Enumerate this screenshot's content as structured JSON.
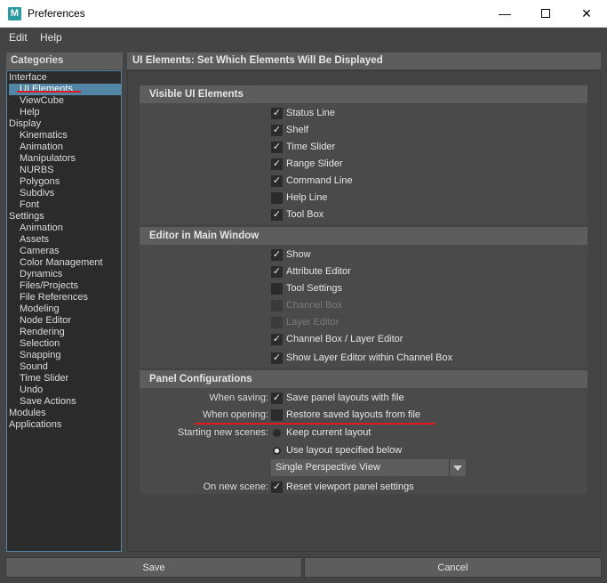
{
  "window": {
    "title": "Preferences",
    "app_icon": "M"
  },
  "menu": [
    "Edit",
    "Help"
  ],
  "categories_header": "Categories",
  "categories": [
    {
      "label": "Interface",
      "level": 0
    },
    {
      "label": "UI Elements",
      "level": 1,
      "selected": true
    },
    {
      "label": "ViewCube",
      "level": 1
    },
    {
      "label": "Help",
      "level": 1
    },
    {
      "label": "Display",
      "level": 0
    },
    {
      "label": "Kinematics",
      "level": 1
    },
    {
      "label": "Animation",
      "level": 1
    },
    {
      "label": "Manipulators",
      "level": 1
    },
    {
      "label": "NURBS",
      "level": 1
    },
    {
      "label": "Polygons",
      "level": 1
    },
    {
      "label": "Subdivs",
      "level": 1
    },
    {
      "label": "Font",
      "level": 1
    },
    {
      "label": "Settings",
      "level": 0
    },
    {
      "label": "Animation",
      "level": 1
    },
    {
      "label": "Assets",
      "level": 1
    },
    {
      "label": "Cameras",
      "level": 1
    },
    {
      "label": "Color Management",
      "level": 1
    },
    {
      "label": "Dynamics",
      "level": 1
    },
    {
      "label": "Files/Projects",
      "level": 1
    },
    {
      "label": "File References",
      "level": 1
    },
    {
      "label": "Modeling",
      "level": 1
    },
    {
      "label": "Node Editor",
      "level": 1
    },
    {
      "label": "Rendering",
      "level": 1
    },
    {
      "label": "Selection",
      "level": 1
    },
    {
      "label": "Snapping",
      "level": 1
    },
    {
      "label": "Sound",
      "level": 1
    },
    {
      "label": "Time Slider",
      "level": 1
    },
    {
      "label": "Undo",
      "level": 1
    },
    {
      "label": "Save Actions",
      "level": 1
    },
    {
      "label": "Modules",
      "level": 0
    },
    {
      "label": "Applications",
      "level": 0
    }
  ],
  "pane_title": "UI Elements: Set Which Elements Will Be Displayed",
  "visible_ui": {
    "header": "Visible UI Elements",
    "items": [
      {
        "label": "Status Line",
        "checked": true
      },
      {
        "label": "Shelf",
        "checked": true
      },
      {
        "label": "Time Slider",
        "checked": true
      },
      {
        "label": "Range Slider",
        "checked": true
      },
      {
        "label": "Command Line",
        "checked": true
      },
      {
        "label": "Help Line",
        "checked": false
      },
      {
        "label": "Tool Box",
        "checked": true
      }
    ]
  },
  "editor_main": {
    "header": "Editor in Main Window",
    "items": [
      {
        "label": "Show",
        "checked": true
      },
      {
        "label": "Attribute Editor",
        "checked": true
      },
      {
        "label": "Tool Settings",
        "checked": false
      },
      {
        "label": "Channel Box",
        "checked": false,
        "disabled": true
      },
      {
        "label": "Layer Editor",
        "checked": false,
        "disabled": true
      },
      {
        "label": "Channel Box / Layer Editor",
        "checked": true
      },
      {
        "label": "Show Layer Editor within Channel Box",
        "checked": true
      }
    ]
  },
  "panel_config": {
    "header": "Panel Configurations",
    "when_saving_label": "When saving:",
    "when_saving_option": "Save panel layouts with file",
    "when_opening_label": "When opening:",
    "when_opening_option": "Restore saved layouts from file",
    "new_scenes_label": "Starting new scenes:",
    "radio_keep": "Keep current layout",
    "radio_use": "Use layout specified below",
    "layout_value": "Single Perspective View",
    "on_new_scene_label": "On new scene:",
    "on_new_scene_option": "Reset viewport panel settings"
  },
  "buttons": {
    "save": "Save",
    "cancel": "Cancel"
  },
  "colors": {
    "accent": "#5285a6",
    "annotation": "#e0191f"
  }
}
